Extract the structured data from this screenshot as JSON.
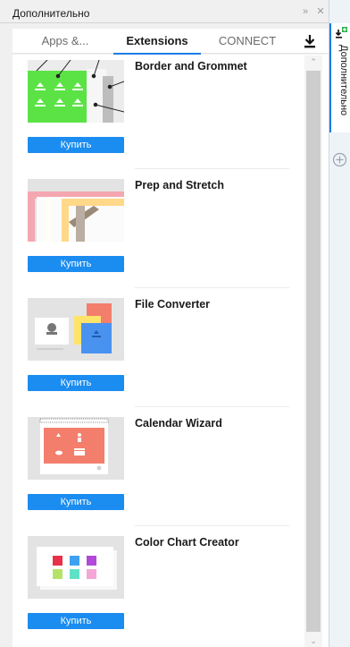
{
  "window": {
    "title": "Дополнительно"
  },
  "tabs": [
    {
      "label": "Apps &..."
    },
    {
      "label": "Extensions"
    },
    {
      "label": "CONNECT"
    }
  ],
  "items": [
    {
      "name": "Border and Grommet",
      "buy_label": "Купить"
    },
    {
      "name": "Prep and Stretch",
      "buy_label": "Купить"
    },
    {
      "name": "File Converter",
      "buy_label": "Купить"
    },
    {
      "name": "Calendar Wizard",
      "buy_label": "Купить"
    },
    {
      "name": "Color Chart Creator",
      "buy_label": "Купить"
    }
  ],
  "side": {
    "tab_label": "Дополнительно"
  },
  "colors": {
    "accent": "#1b8cf0",
    "green": "#5be346",
    "salmon": "#f37e6c"
  }
}
